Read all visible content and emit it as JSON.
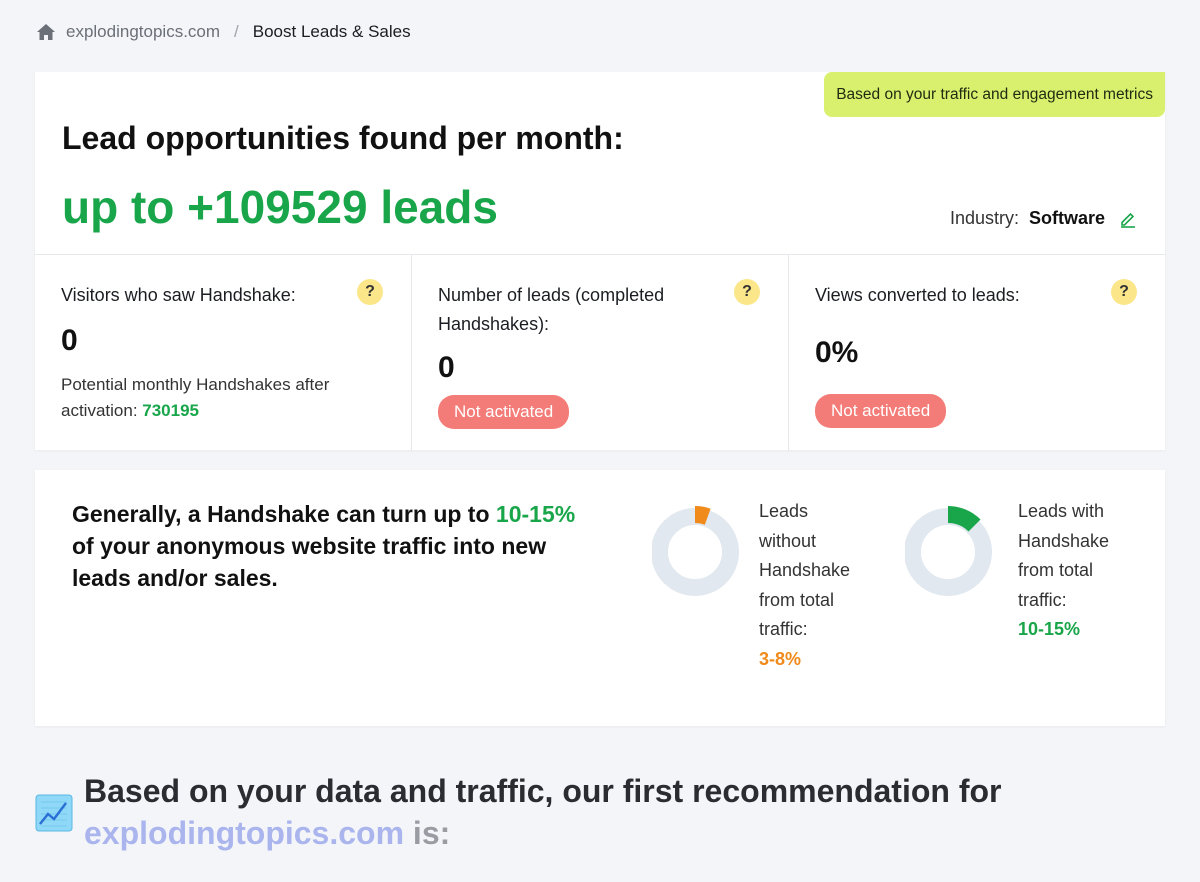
{
  "breadcrumb": {
    "domain": "explodingtopics.com",
    "separator": "/",
    "current": "Boost Leads & Sales"
  },
  "main": {
    "badge": "Based on your traffic and engagement metrics",
    "headline": "Lead opportunities found per month:",
    "leads": "up to +109529 leads",
    "industry_label": "Industry:",
    "industry_value": "Software"
  },
  "stats": [
    {
      "title": "Visitors who saw Handshake:",
      "value": "0",
      "sub_prefix": "Potential monthly Handshakes after activation: ",
      "sub_value": "730195"
    },
    {
      "title": "Number of leads (completed Handshakes):",
      "value": "0",
      "status": "Not activated"
    },
    {
      "title": "Views converted to leads:",
      "value": "0%",
      "status": "Not activated"
    }
  ],
  "help_glyph": "?",
  "info": {
    "text_before": "Generally, a Handshake can turn up to ",
    "text_highlight": "10-15%",
    "text_after": " of your anonymous website traffic into new leads and/or sales.",
    "donuts": [
      {
        "label_lines": [
          "Leads",
          "without",
          "Handshake",
          "from total",
          "traffic:"
        ],
        "pct": "3-8%",
        "fraction": 0.055,
        "color": "#f08a1a"
      },
      {
        "label_lines": [
          "Leads with",
          "Handshake",
          "from total",
          "traffic:"
        ],
        "pct": "10-15%",
        "fraction": 0.125,
        "color": "#19a64a"
      }
    ]
  },
  "reco": {
    "line1": "Based on your data and traffic, our first recommendation for",
    "domain": "explodingtopics.com",
    "suffix": " is:"
  }
}
